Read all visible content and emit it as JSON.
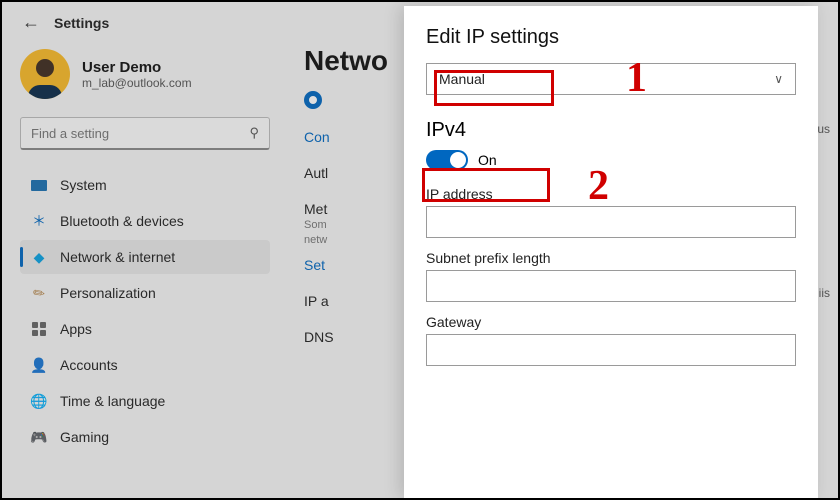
{
  "header": {
    "title": "Settings"
  },
  "user": {
    "name": "User Demo",
    "email": "m_lab@outlook.com"
  },
  "search": {
    "placeholder": "Find a setting"
  },
  "nav": {
    "system": "System",
    "bluetooth": "Bluetooth & devices",
    "network": "Network & internet",
    "personalization": "Personalization",
    "apps": "Apps",
    "accounts": "Accounts",
    "time": "Time & language",
    "gaming": "Gaming"
  },
  "main": {
    "page_title_visible": "Netwo",
    "configure_link": "Con",
    "auth_label": "Autl",
    "metered_label": "Met",
    "metered_hint_a": "Som",
    "metered_hint_b": "netw",
    "set_link": "Set",
    "ip_label": "IP a",
    "dns_label": "DNS",
    "right_hint_a": "r us",
    "right_hint_b": "iis"
  },
  "modal": {
    "title": "Edit IP settings",
    "select_value": "Manual",
    "ipv4_title": "IPv4",
    "toggle_state": "On",
    "field_ip": "IP address",
    "field_subnet": "Subnet prefix length",
    "field_gateway": "Gateway"
  },
  "callouts": {
    "one": "1",
    "two": "2"
  }
}
